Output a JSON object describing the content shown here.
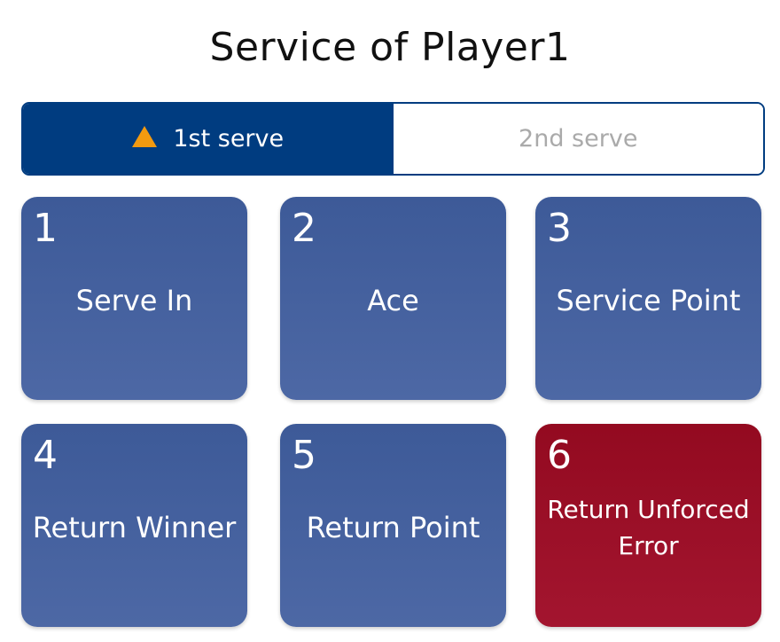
{
  "header": {
    "title": "Service of Player1"
  },
  "serve_toggle": {
    "tabs": [
      {
        "label": "1st serve",
        "active": true,
        "icon": "warning-triangle-icon"
      },
      {
        "label": "2nd serve",
        "active": false
      }
    ]
  },
  "tiles": [
    {
      "number": "1",
      "label": "Serve In"
    },
    {
      "number": "2",
      "label": "Ace"
    },
    {
      "number": "3",
      "label": "Service Point"
    },
    {
      "number": "4",
      "label": "Return Winner"
    },
    {
      "number": "5",
      "label": "Return Point"
    },
    {
      "number": "6",
      "label": "Return Unforced Error"
    }
  ],
  "colors": {
    "primary": "#003c80",
    "tile": "#445fa0",
    "error": "#9a0f27",
    "warning": "#f29a10"
  }
}
